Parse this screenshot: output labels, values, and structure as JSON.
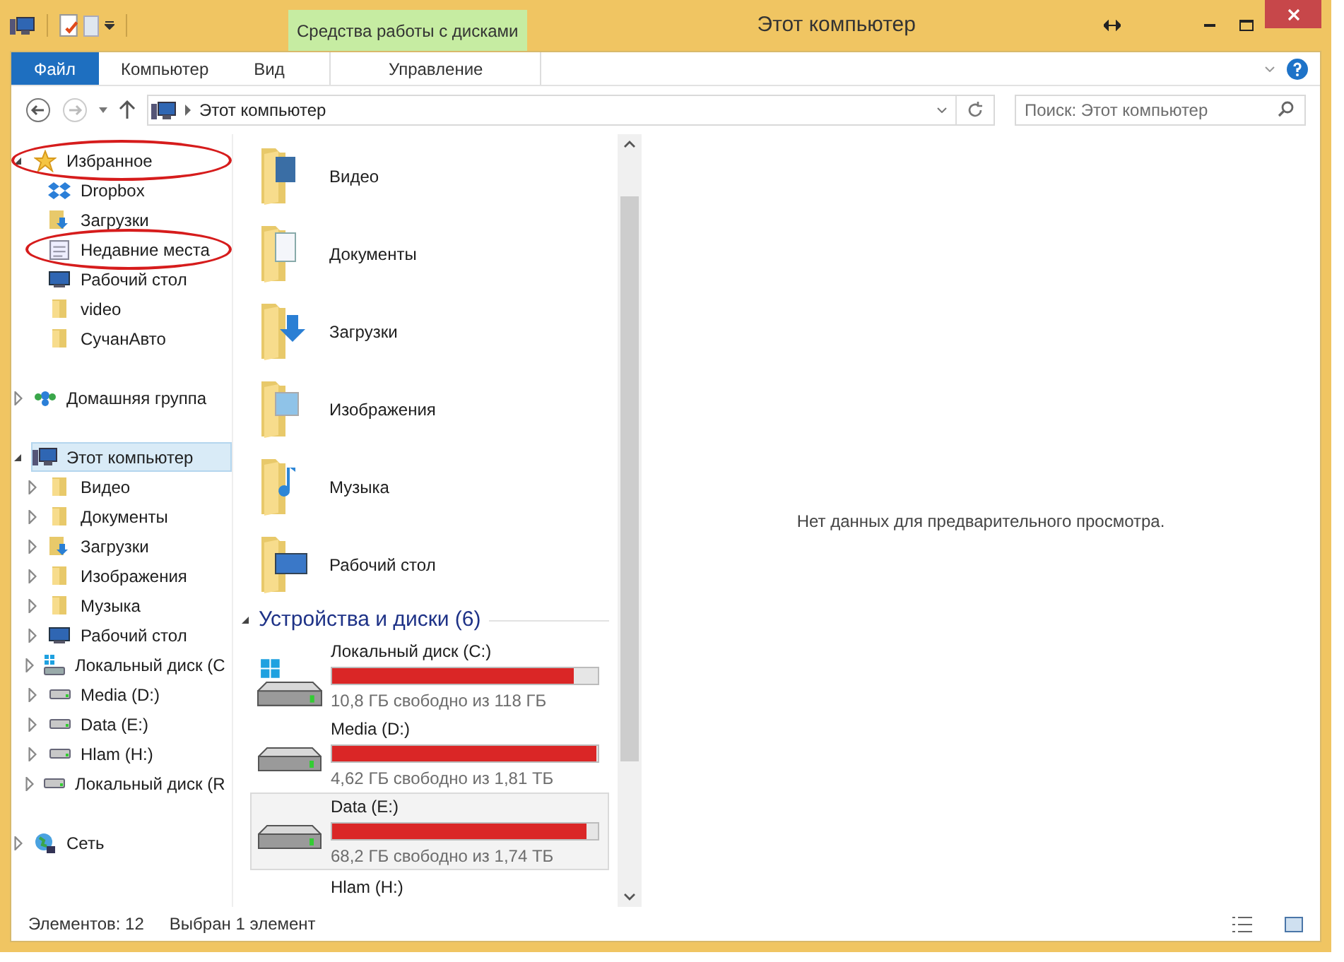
{
  "window": {
    "title": "Этот компьютер",
    "context_tab_group": "Средства работы с дисками"
  },
  "ribbon_tabs": [
    {
      "label": "Файл",
      "kind": "file",
      "selected": false
    },
    {
      "label": "Компьютер",
      "kind": "tab",
      "selected": false
    },
    {
      "label": "Вид",
      "kind": "tab",
      "selected": false
    },
    {
      "label": "Управление",
      "kind": "context",
      "selected": false
    }
  ],
  "address_bar": {
    "path": "Этот компьютер"
  },
  "search": {
    "placeholder": "Поиск: Этот компьютер"
  },
  "sidebar": [
    {
      "label": "Избранное",
      "kind": "star",
      "expanded": true,
      "selected": false,
      "circled": true,
      "children": [
        {
          "label": "Dropbox",
          "kind": "dropbox",
          "expandable": false,
          "circled": false
        },
        {
          "label": "Загрузки",
          "kind": "download",
          "expandable": false,
          "circled": false
        },
        {
          "label": "Недавние места",
          "kind": "recent",
          "expandable": false,
          "circled": true
        },
        {
          "label": "Рабочий стол",
          "kind": "desktop",
          "expandable": false,
          "circled": false
        },
        {
          "label": "video",
          "kind": "folder",
          "expandable": false,
          "circled": false
        },
        {
          "label": "СучанАвто",
          "kind": "folder",
          "expandable": false,
          "circled": false
        }
      ]
    },
    {
      "label": "Домашняя группа",
      "kind": "homegroup",
      "expanded": false,
      "selected": false,
      "circled": false
    },
    {
      "label": "Этот компьютер",
      "kind": "computer",
      "expanded": true,
      "selected": true,
      "circled": false,
      "children": [
        {
          "label": "Видео",
          "kind": "folder",
          "expandable": true,
          "circled": false
        },
        {
          "label": "Документы",
          "kind": "folder",
          "expandable": true,
          "circled": false
        },
        {
          "label": "Загрузки",
          "kind": "download",
          "expandable": true,
          "circled": false
        },
        {
          "label": "Изображения",
          "kind": "folder",
          "expandable": true,
          "circled": false
        },
        {
          "label": "Музыка",
          "kind": "folder",
          "expandable": true,
          "circled": false
        },
        {
          "label": "Рабочий стол",
          "kind": "desktop",
          "expandable": true,
          "circled": false
        },
        {
          "label": "Локальный диск (C",
          "kind": "windrive",
          "expandable": true,
          "circled": false
        },
        {
          "label": "Media (D:)",
          "kind": "drive",
          "expandable": true,
          "circled": false
        },
        {
          "label": "Data (E:)",
          "kind": "drive",
          "expandable": true,
          "circled": false
        },
        {
          "label": "Hlam (H:)",
          "kind": "drive",
          "expandable": true,
          "circled": false
        },
        {
          "label": "Локальный диск (R",
          "kind": "drive",
          "expandable": true,
          "circled": false
        }
      ]
    },
    {
      "label": "Сеть",
      "kind": "network",
      "expanded": false,
      "selected": false,
      "circled": false
    }
  ],
  "folders": [
    {
      "label": "Видео",
      "kind": "video"
    },
    {
      "label": "Документы",
      "kind": "docs"
    },
    {
      "label": "Загрузки",
      "kind": "download"
    },
    {
      "label": "Изображения",
      "kind": "pictures"
    },
    {
      "label": "Музыка",
      "kind": "music"
    },
    {
      "label": "Рабочий стол",
      "kind": "desktop"
    }
  ],
  "devices_group": {
    "title": "Устройства и диски (6)",
    "expanded": true
  },
  "drives": [
    {
      "name": "Локальный диск (C:)",
      "kind": "system",
      "level": 0.91,
      "info": "10,8 ГБ свободно из 118 ГБ",
      "selected": false
    },
    {
      "name": "Media (D:)",
      "kind": "data",
      "level": 0.997,
      "info": "4,62 ГБ свободно из 1,81 ТБ",
      "selected": false
    },
    {
      "name": "Data (E:)",
      "kind": "data",
      "level": 0.96,
      "info": "68,2 ГБ свободно из 1,74 ТБ",
      "selected": true
    },
    {
      "name": "Hlam (H:)",
      "kind": "partial",
      "selected": false
    }
  ],
  "preview": {
    "message": "Нет данных для предварительного просмотра."
  },
  "status_bar": {
    "count": "Элементов: 12",
    "selection": "Выбран 1 элемент"
  }
}
